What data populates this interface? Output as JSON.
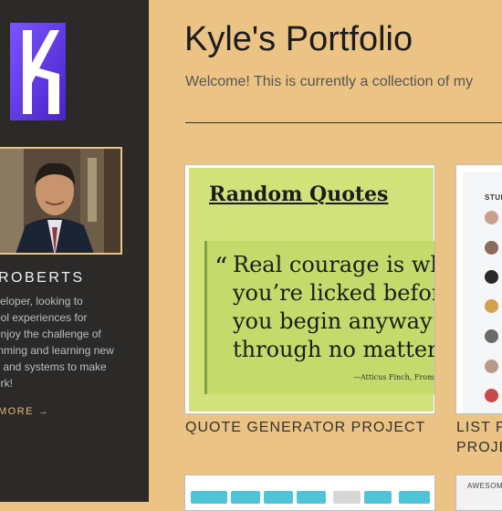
{
  "sidebar": {
    "name": "ROBERTS",
    "bio_lines": [
      "veloper, looking to",
      "ool experiences for",
      "enjoy the challenge of",
      "mming and learning new",
      "s and systems to make",
      "ork!"
    ],
    "more_label": "MORE",
    "more_arrow": "→"
  },
  "header": {
    "title": "Kyle's Portfolio",
    "welcome": "Welcome! This is currently a collection of my"
  },
  "projects": [
    {
      "label": "QUOTE GENERATOR PROJECT",
      "preview": {
        "heading": "Random Quotes",
        "quote_mark": "“",
        "quote_lines": [
          "Real courage is whe",
          "you’re licked befor",
          "you begin anyway a",
          "through no matter"
        ],
        "attribution": "—Atticus Finch, From..."
      }
    },
    {
      "label_lines": [
        "LIST PA",
        "PROJE"
      ],
      "preview": {
        "heading": "STUI"
      }
    },
    {
      "label": ""
    },
    {
      "preview": {
        "heading": "AWESOM"
      }
    }
  ],
  "colors": {
    "background": "#ebc384",
    "sidebar": "#2b2a29",
    "accent": "#e6b872",
    "quote_bg": "#d2e27a",
    "logo": "#6b3ff2"
  }
}
